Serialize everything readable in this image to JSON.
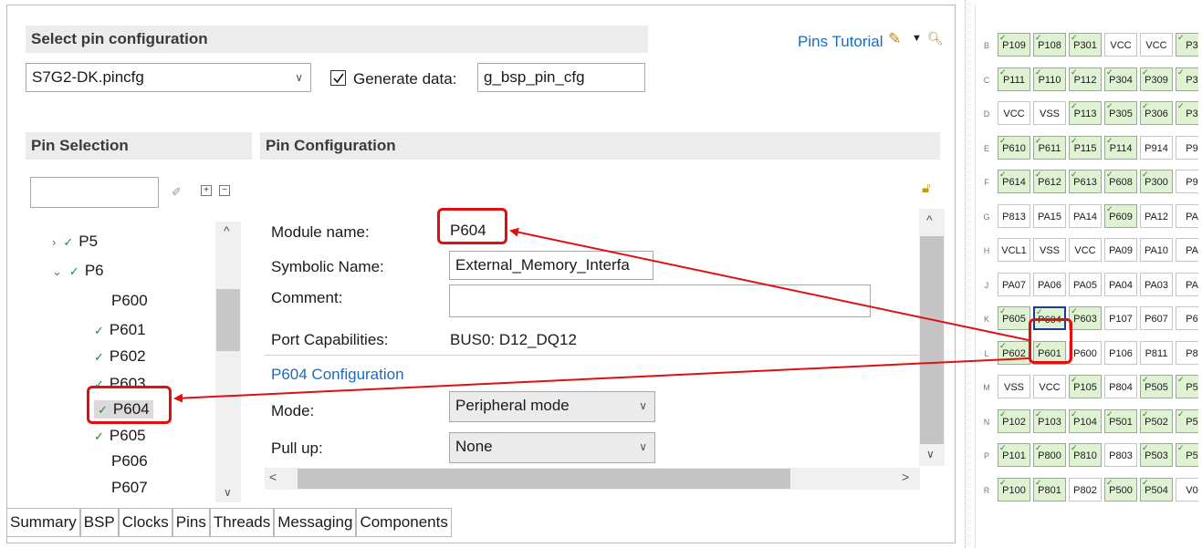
{
  "select_config": {
    "header": "Select pin configuration",
    "file": "S7G2-DK.pincfg",
    "generate_label": "Generate data:",
    "generate_value": "g_bsp_pin_cfg",
    "tutorial_link": "Pins Tutorial"
  },
  "pin_selection": {
    "header": "Pin Selection",
    "search_value": "",
    "tree": [
      {
        "label": "P5",
        "level": 0,
        "caret": ">",
        "tick": true
      },
      {
        "label": "P6",
        "level": 0,
        "caret": "v",
        "tick": true
      },
      {
        "label": "P600",
        "level": 1,
        "tick": false
      },
      {
        "label": "P601",
        "level": 1,
        "tick": true
      },
      {
        "label": "P602",
        "level": 1,
        "tick": true
      },
      {
        "label": "P603",
        "level": 1,
        "tick": true
      },
      {
        "label": "P604",
        "level": 1,
        "tick": true
      },
      {
        "label": "P605",
        "level": 1,
        "tick": true
      },
      {
        "label": "P606",
        "level": 1,
        "tick": false
      },
      {
        "label": "P607",
        "level": 1,
        "tick": false
      }
    ]
  },
  "pin_config": {
    "header": "Pin Configuration",
    "module_name_label": "Module name:",
    "module_name_value": "P604",
    "symbolic_label": "Symbolic Name:",
    "symbolic_value": "External_Memory_Interfa",
    "comment_label": "Comment:",
    "comment_value": "",
    "port_cap_label": "Port Capabilities:",
    "port_cap_value": "BUS0: D12_DQ12",
    "section_title": "P604 Configuration",
    "mode_label": "Mode:",
    "mode_value": "Peripheral mode",
    "pullup_label": "Pull up:",
    "pullup_value": "None"
  },
  "tabs": [
    "Summary",
    "BSP",
    "Clocks",
    "Pins",
    "Threads",
    "Messaging",
    "Components"
  ],
  "pin_grid": {
    "rows": [
      {
        "label": "B",
        "cells": [
          [
            "P109",
            "g"
          ],
          [
            "P108",
            "g"
          ],
          [
            "P301",
            "g"
          ],
          [
            "VCC",
            "w"
          ],
          [
            "VCC",
            "w"
          ],
          [
            "P3",
            "g"
          ]
        ]
      },
      {
        "label": "C",
        "cells": [
          [
            "P111",
            "g"
          ],
          [
            "P110",
            "g"
          ],
          [
            "P112",
            "g"
          ],
          [
            "P304",
            "g"
          ],
          [
            "P309",
            "g"
          ],
          [
            "P3",
            "g"
          ]
        ]
      },
      {
        "label": "D",
        "cells": [
          [
            "VCC",
            "w"
          ],
          [
            "VSS",
            "w"
          ],
          [
            "P113",
            "g"
          ],
          [
            "P305",
            "g"
          ],
          [
            "P306",
            "g"
          ],
          [
            "P3",
            "g"
          ]
        ]
      },
      {
        "label": "E",
        "cells": [
          [
            "P610",
            "g"
          ],
          [
            "P611",
            "g"
          ],
          [
            "P115",
            "g"
          ],
          [
            "P114",
            "g"
          ],
          [
            "P914",
            "w"
          ],
          [
            "P9",
            "w"
          ]
        ]
      },
      {
        "label": "F",
        "cells": [
          [
            "P614",
            "g"
          ],
          [
            "P612",
            "g"
          ],
          [
            "P613",
            "g"
          ],
          [
            "P608",
            "g"
          ],
          [
            "P300",
            "g"
          ],
          [
            "P9",
            "w"
          ]
        ]
      },
      {
        "label": "G",
        "cells": [
          [
            "P813",
            "w"
          ],
          [
            "PA15",
            "w"
          ],
          [
            "PA14",
            "w"
          ],
          [
            "P609",
            "g"
          ],
          [
            "PA12",
            "w"
          ],
          [
            "PA",
            "w"
          ]
        ]
      },
      {
        "label": "H",
        "cells": [
          [
            "VCL1",
            "w"
          ],
          [
            "VSS",
            "w"
          ],
          [
            "VCC",
            "w"
          ],
          [
            "PA09",
            "w"
          ],
          [
            "PA10",
            "w"
          ],
          [
            "PA",
            "w"
          ]
        ]
      },
      {
        "label": "J",
        "cells": [
          [
            "PA07",
            "w"
          ],
          [
            "PA06",
            "w"
          ],
          [
            "PA05",
            "w"
          ],
          [
            "PA04",
            "w"
          ],
          [
            "PA03",
            "w"
          ],
          [
            "PA",
            "w"
          ]
        ]
      },
      {
        "label": "K",
        "cells": [
          [
            "P605",
            "g"
          ],
          [
            "P604",
            "gs"
          ],
          [
            "P603",
            "g"
          ],
          [
            "P107",
            "w"
          ],
          [
            "P607",
            "w"
          ],
          [
            "P6",
            "w"
          ]
        ]
      },
      {
        "label": "L",
        "cells": [
          [
            "P602",
            "g"
          ],
          [
            "P601",
            "g"
          ],
          [
            "P600",
            "w"
          ],
          [
            "P106",
            "w"
          ],
          [
            "P811",
            "w"
          ],
          [
            "P8",
            "w"
          ]
        ]
      },
      {
        "label": "M",
        "cells": [
          [
            "VSS",
            "w"
          ],
          [
            "VCC",
            "w"
          ],
          [
            "P105",
            "g"
          ],
          [
            "P804",
            "w"
          ],
          [
            "P505",
            "g"
          ],
          [
            "P5",
            "g"
          ]
        ]
      },
      {
        "label": "N",
        "cells": [
          [
            "P102",
            "g"
          ],
          [
            "P103",
            "g"
          ],
          [
            "P104",
            "g"
          ],
          [
            "P501",
            "g"
          ],
          [
            "P502",
            "g"
          ],
          [
            "P5",
            "g"
          ]
        ]
      },
      {
        "label": "P",
        "cells": [
          [
            "P101",
            "g"
          ],
          [
            "P800",
            "g"
          ],
          [
            "P810",
            "g"
          ],
          [
            "P803",
            "w"
          ],
          [
            "P503",
            "g"
          ],
          [
            "P5",
            "g"
          ]
        ]
      },
      {
        "label": "R",
        "cells": [
          [
            "P100",
            "g"
          ],
          [
            "P801",
            "g"
          ],
          [
            "P802",
            "w"
          ],
          [
            "P500",
            "g"
          ],
          [
            "P504",
            "g"
          ],
          [
            "V0",
            "w"
          ]
        ]
      }
    ]
  },
  "colors": {
    "accent": "#e01010",
    "link": "#1b6cc0",
    "pin_green": "#dff3d3"
  }
}
